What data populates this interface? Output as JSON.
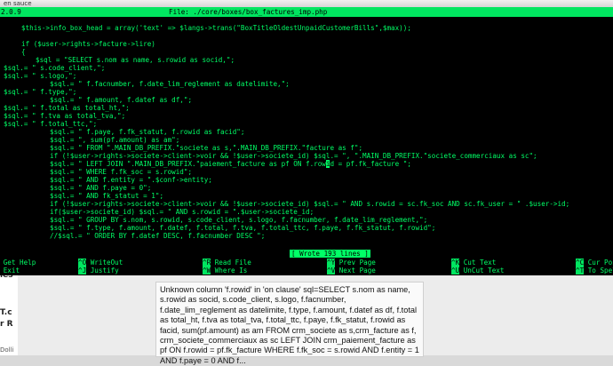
{
  "browser": {
    "title_fragment": "en sauce",
    "left_labels": [
      "ies",
      "T.c",
      "r R"
    ],
    "left_bottom": "Dolli"
  },
  "error_message": "Unknown column 'f.rowid' in 'on clause' sql=SELECT s.nom as name, s.rowid as socid, s.code_client, s.logo, f.facnumber, f.date_lim_reglement as datelimite, f.type, f.amount, f.datef as df, f.total as total_ht, f.tva as total_tva, f.total_ttc, f.paye, f.fk_statut, f.rowid as facid, sum(pf.amount) as am FROM crm_societe as s,crm_facture as f, crm_societe_commerciaux as sc LEFT JOIN crm_paiement_facture as pf ON f.rowid = pf.fk_facture WHERE f.fk_soc = s.rowid AND f.entity = 1 AND f.paye = 0 AND f...",
  "nano": {
    "version": "2.0.9",
    "file_label": "File: ./core/boxes/box_factures_imp.php",
    "code_lines": [
      {
        "indent": 24,
        "text": "$this->info_box_head = array('text' => $langs->trans(\"BoxTitleOldestUnpaidCustomerBills\",$max));"
      },
      {
        "indent": 0,
        "text": ""
      },
      {
        "indent": 24,
        "text": "if ($user->rights->facture->lire)"
      },
      {
        "indent": 24,
        "text": "{"
      },
      {
        "indent": 40,
        "text": "$sql = \"SELECT s.nom as name, s.rowid as socid,\";"
      },
      {
        "indent": 4,
        "text": "$sql.= \" s.code_client,\";"
      },
      {
        "indent": 4,
        "text": "$sql.= \" s.logo,\";"
      },
      {
        "indent": 56,
        "text": "$sql.= \" f.facnumber, f.date_lim_reglement as datelimite,\";"
      },
      {
        "indent": 4,
        "text": "$sql.= \" f.type,\";"
      },
      {
        "indent": 56,
        "text": "$sql.= \" f.amount, f.datef as df,\";"
      },
      {
        "indent": 4,
        "text": "$sql.= \" f.total as total_ht,\";"
      },
      {
        "indent": 4,
        "text": "$sql.= \" f.tva as total_tva,\";"
      },
      {
        "indent": 4,
        "text": "$sql.= \" f.total_ttc,\";"
      },
      {
        "indent": 56,
        "text": "$sql.= \" f.paye, f.fk_statut, f.rowid as facid\";"
      },
      {
        "indent": 56,
        "text": "$sql.= \", sum(pf.amount) as am\";"
      },
      {
        "indent": 56,
        "text": "$sql.= \" FROM \".MAIN_DB_PREFIX.\"societe as s,\".MAIN_DB_PREFIX.\"facture as f\";"
      },
      {
        "indent": 56,
        "text": "if (!$user->rights->societe->client->voir && !$user->societe_id) $sql.= \", \".MAIN_DB_PREFIX.\"societe_commerciaux as sc\";"
      },
      {
        "indent": 56,
        "text": "$sql.= \" LEFT JOIN \".MAIN_DB_PREFIX.\"paiement_facture as pf ON f.rowid = pf.fk_facture \";",
        "cursor_after": "f.row",
        "cursor_char": "i"
      },
      {
        "indent": 56,
        "text": "$sql.= \" WHERE f.fk_soc = s.rowid\";"
      },
      {
        "indent": 56,
        "text": "$sql.= \" AND f.entity = \".$conf->entity;"
      },
      {
        "indent": 56,
        "text": "$sql.= \" AND f.paye = 0\";"
      },
      {
        "indent": 56,
        "text": "$sql.= \" AND fk_statut = 1\";"
      },
      {
        "indent": 56,
        "text": "if (!$user->rights->societe->client->voir && !$user->societe_id) $sql.= \" AND s.rowid = sc.fk_soc AND sc.fk_user = \" .$user->id;"
      },
      {
        "indent": 56,
        "text": "if($user->societe_id) $sql.= \" AND s.rowid = \".$user->societe_id;"
      },
      {
        "indent": 56,
        "text": "$sql.= \" GROUP BY s.nom, s.rowid, s.code_client, s.logo, f.facnumber, f.date_lim_reglement,\";"
      },
      {
        "indent": 56,
        "text": "$sql.= \" f.type, f.amount, f.datef, f.total, f.tva, f.total_ttc, f.paye, f.fk_statut, f.rowid\";"
      },
      {
        "indent": 56,
        "text": "//$sql.= \" ORDER BY f.datef DESC, f.facnumber DESC \";"
      }
    ],
    "status": "[ Wrote 193 lines ]",
    "shortcuts_row1": [
      {
        "key": "^G",
        "label": "Get Help"
      },
      {
        "key": "^O",
        "label": "WriteOut"
      },
      {
        "key": "^R",
        "label": "Read File"
      },
      {
        "key": "^Y",
        "label": "Prev Page"
      },
      {
        "key": "^K",
        "label": "Cut Text"
      },
      {
        "key": "^C",
        "label": "Cur Pos"
      }
    ],
    "shortcuts_row2": [
      {
        "key": "^X",
        "label": "Exit"
      },
      {
        "key": "^J",
        "label": "Justify"
      },
      {
        "key": "^W",
        "label": "Where Is"
      },
      {
        "key": "^V",
        "label": "Next Page"
      },
      {
        "key": "^U",
        "label": "UnCut Text"
      },
      {
        "key": "^T",
        "label": "To Spell"
      }
    ]
  }
}
